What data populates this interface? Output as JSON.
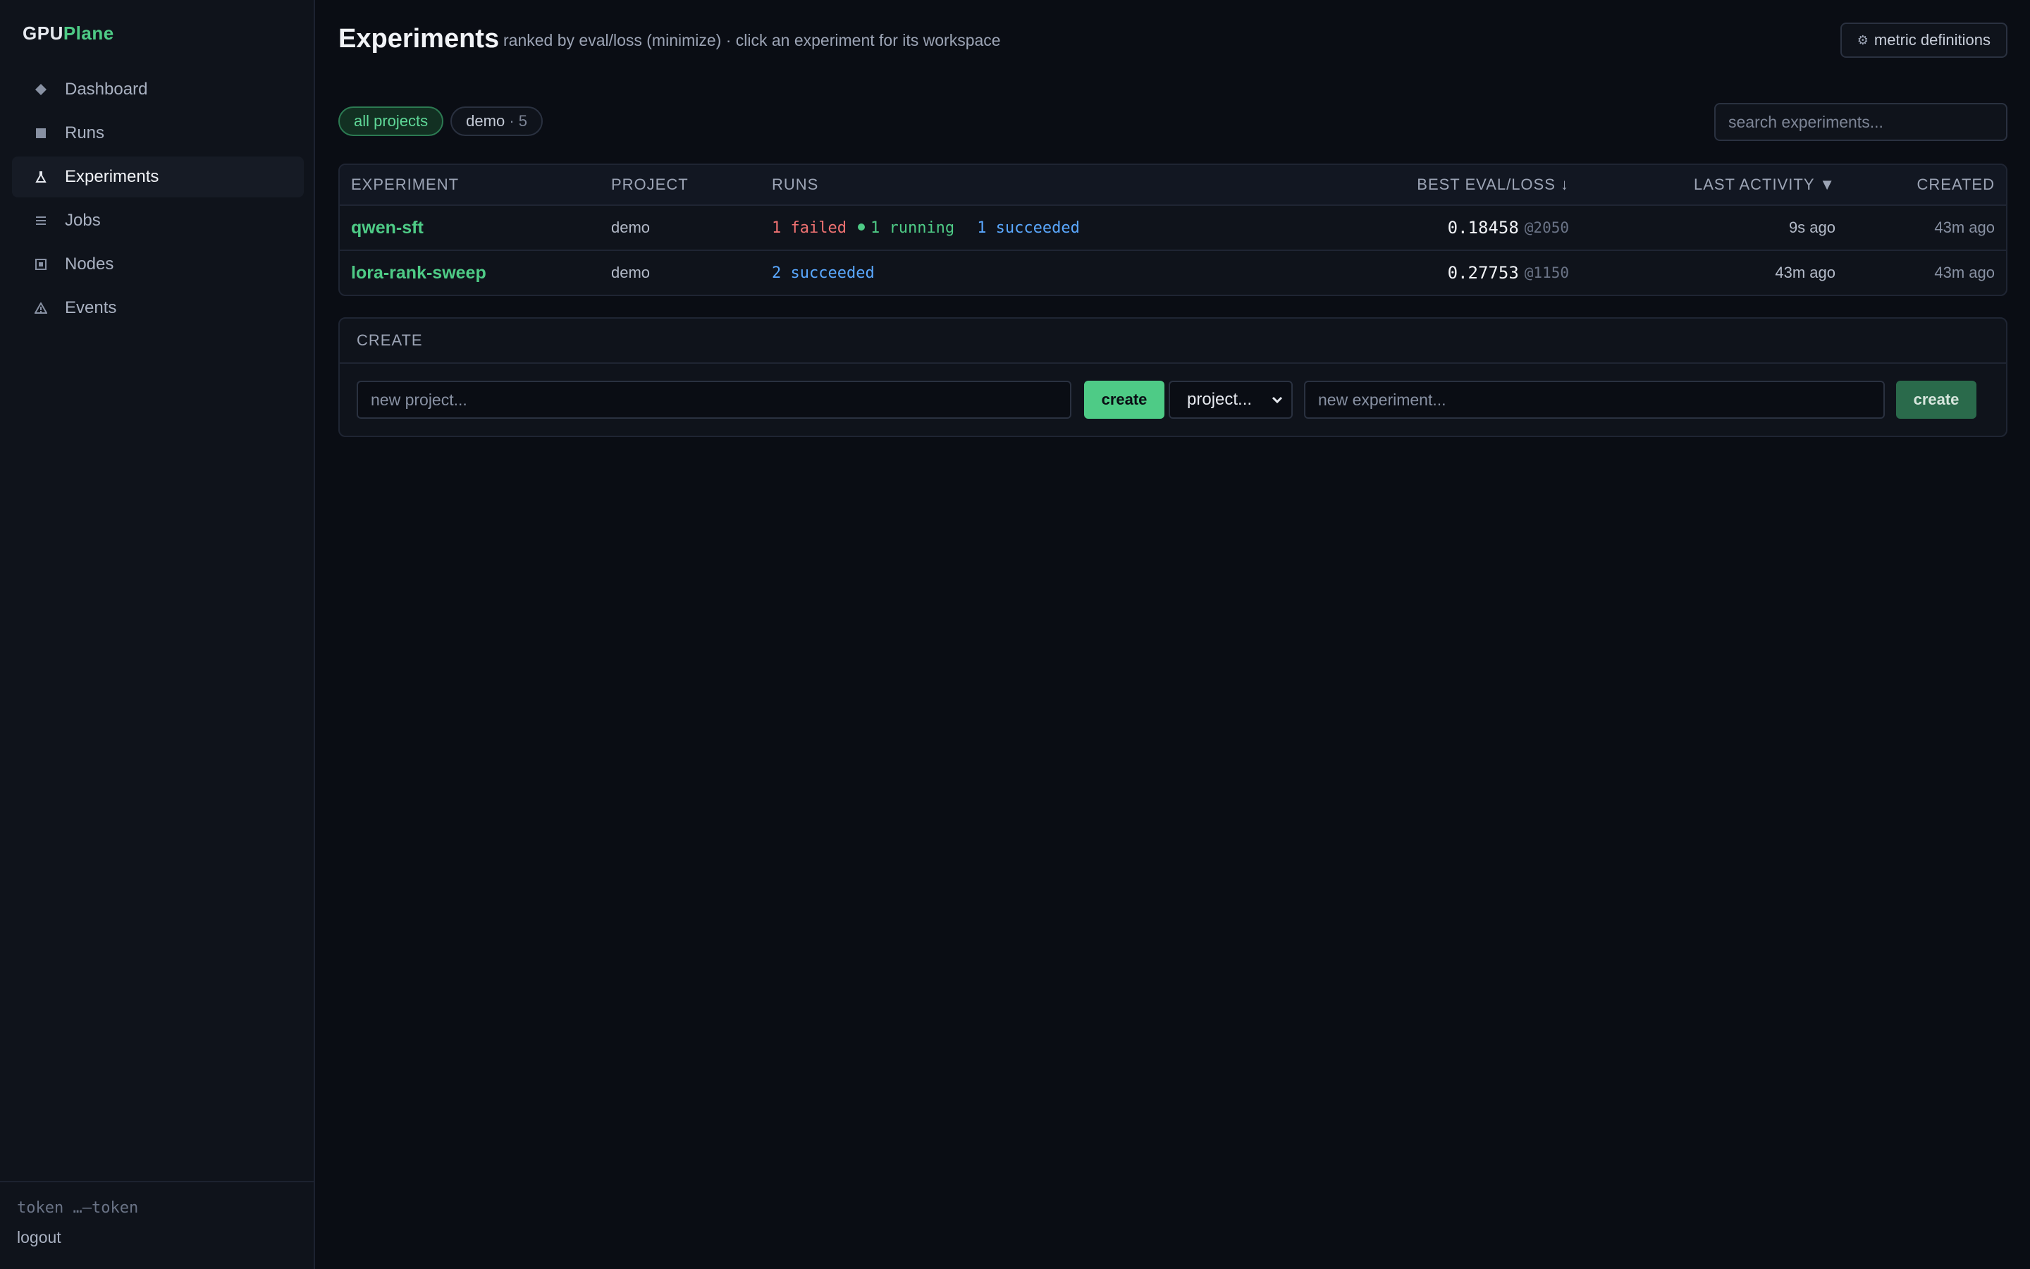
{
  "brand": {
    "part1": "GPU",
    "part2": "Plane"
  },
  "sidebar": {
    "items": [
      {
        "label": "Dashboard",
        "icon": "diamond-icon"
      },
      {
        "label": "Runs",
        "icon": "square-icon"
      },
      {
        "label": "Experiments",
        "icon": "flask-icon",
        "active": true
      },
      {
        "label": "Jobs",
        "icon": "list-icon"
      },
      {
        "label": "Nodes",
        "icon": "node-icon"
      },
      {
        "label": "Events",
        "icon": "warning-icon"
      }
    ],
    "token": "token …—token",
    "logout": "logout"
  },
  "header": {
    "title": "Experiments",
    "subtitle": "ranked by eval/loss (minimize) · click an experiment for its workspace",
    "metric_button": "metric definitions"
  },
  "filters": {
    "all": "all projects",
    "demo_label": "demo",
    "demo_count": "· 5"
  },
  "search": {
    "placeholder": "search experiments..."
  },
  "table": {
    "headers": {
      "experiment": "EXPERIMENT",
      "project": "PROJECT",
      "runs": "RUNS",
      "best": "BEST EVAL/LOSS ↓",
      "last": "LAST ACTIVITY ▼",
      "created": "CREATED"
    },
    "rows": [
      {
        "name": "qwen-sft",
        "project": "demo",
        "failed": "1 failed",
        "running": "1 running",
        "succeeded": "1 succeeded",
        "best": "0.18458",
        "step": "@2050",
        "last": "9s ago",
        "created": "43m ago"
      },
      {
        "name": "lora-rank-sweep",
        "project": "demo",
        "succeeded": "2 succeeded",
        "best": "0.27753",
        "step": "@1150",
        "last": "43m ago",
        "created": "43m ago"
      }
    ]
  },
  "create": {
    "heading": "CREATE",
    "project_placeholder": "new project...",
    "create_label": "create",
    "project_select": "project...",
    "experiment_placeholder": "new experiment...",
    "create_label_2": "create"
  },
  "colors": {
    "accent": "#4ecb86",
    "failed": "#f07272",
    "succeeded": "#5aa8ff",
    "background": "#0a0d14"
  }
}
